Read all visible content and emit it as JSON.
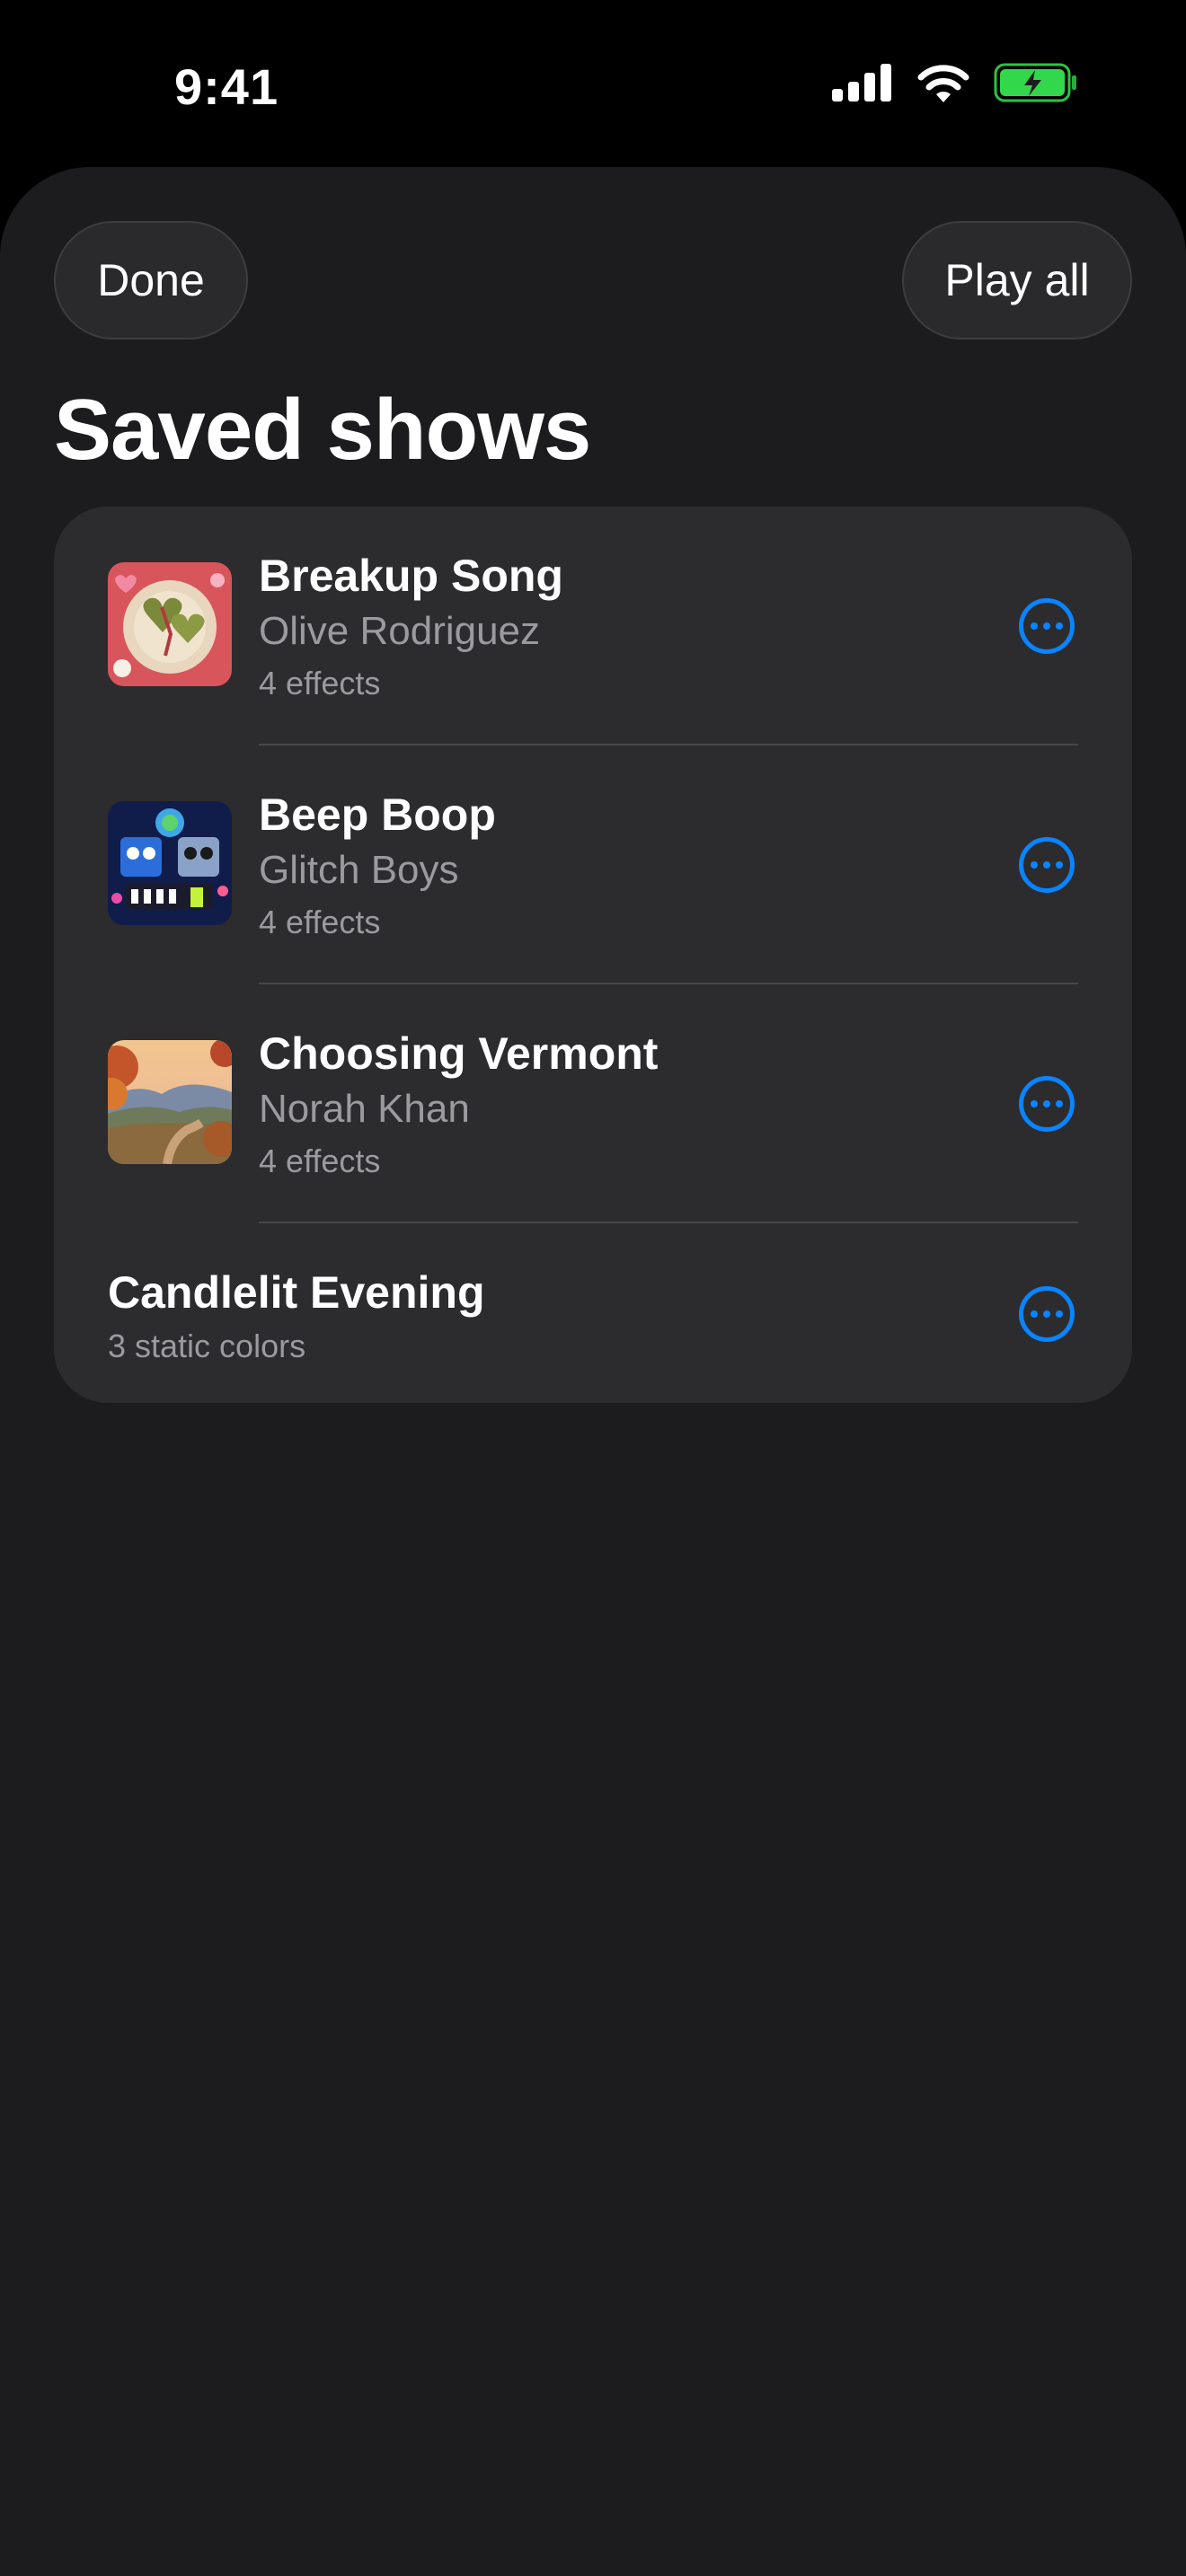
{
  "status_bar": {
    "time": "9:41",
    "icons": [
      "cellular-signal-icon",
      "wifi-icon",
      "battery-charging-icon"
    ],
    "battery_color": "#32d74b"
  },
  "header": {
    "done_label": "Done",
    "play_all_label": "Play all",
    "title": "Saved shows"
  },
  "shows": [
    {
      "title": "Breakup Song",
      "artist": "Olive Rodriguez",
      "detail": "4 effects",
      "artwork": "breakup-song-artwork"
    },
    {
      "title": "Beep Boop",
      "artist": "Glitch Boys",
      "detail": "4 effects",
      "artwork": "beep-boop-artwork"
    },
    {
      "title": "Choosing Vermont",
      "artist": "Norah Khan",
      "detail": "4 effects",
      "artwork": "choosing-vermont-artwork"
    },
    {
      "title": "Candlelit Evening",
      "detail": "3 static colors"
    }
  ],
  "colors": {
    "accent": "#0a84ff",
    "sheet_background": "#1c1c1e",
    "card_background": "#2c2c2e",
    "secondary_text": "#9a9a9f"
  }
}
